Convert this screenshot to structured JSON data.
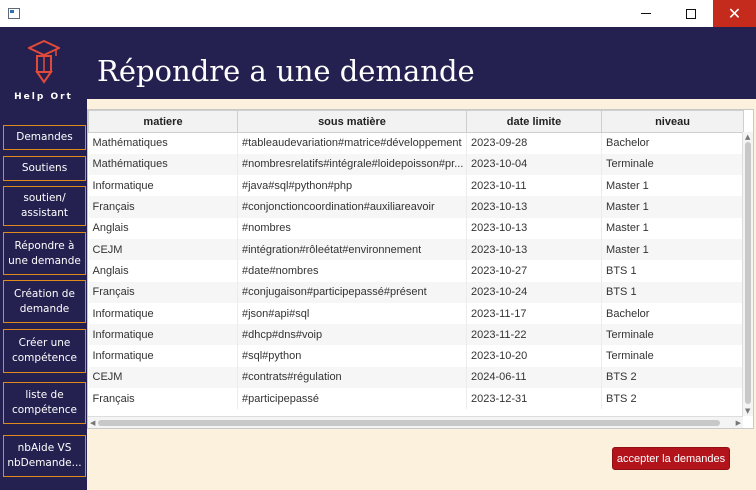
{
  "window": {
    "close_glyph": "✕"
  },
  "sidebar": {
    "logo_text": "Help Ort",
    "items": [
      {
        "label": "Demandes"
      },
      {
        "label": "Soutiens"
      },
      {
        "label": "soutien/ assistant"
      },
      {
        "label": "Répondre à une demande"
      },
      {
        "label": "Création de demande"
      },
      {
        "label": "Créer une compétence"
      },
      {
        "label": "liste de compétence"
      },
      {
        "label": "nbAide VS nbDemande..."
      }
    ]
  },
  "header": {
    "title": "Répondre a une demande"
  },
  "table": {
    "columns": [
      "matiere",
      "sous matière",
      "date limite",
      "niveau"
    ],
    "rows": [
      [
        "Mathématiques",
        "#tableaudevariation#matrice#développement",
        "2023-09-28",
        "Bachelor"
      ],
      [
        "Mathématiques",
        "#nombresrelatifs#intégrale#loidepoisson#pr...",
        "2023-10-04",
        "Terminale"
      ],
      [
        "Informatique",
        "#java#sql#python#php",
        "2023-10-11",
        "Master 1"
      ],
      [
        "Français",
        "#conjonctioncoordination#auxiliareavoir",
        "2023-10-13",
        "Master 1"
      ],
      [
        "Anglais",
        "#nombres",
        "2023-10-13",
        "Master 1"
      ],
      [
        "CEJM",
        "#intégration#rôleétat#environnement",
        "2023-10-13",
        "Master 1"
      ],
      [
        "Anglais",
        "#date#nombres",
        "2023-10-27",
        "BTS 1"
      ],
      [
        "Français",
        "#conjugaison#participepassé#présent",
        "2023-10-24",
        "BTS 1"
      ],
      [
        "Informatique",
        "#json#api#sql",
        "2023-11-17",
        "Bachelor"
      ],
      [
        "Informatique",
        "#dhcp#dns#voip",
        "2023-11-22",
        "Terminale"
      ],
      [
        "Informatique",
        "#sql#python",
        "2023-10-20",
        "Terminale"
      ],
      [
        "CEJM",
        "#contrats#régulation",
        "2024-06-11",
        "BTS 2"
      ],
      [
        "Français",
        "#participepassé",
        "2023-12-31",
        "BTS 2"
      ]
    ]
  },
  "actions": {
    "accept_label": "accepter la demandes"
  },
  "icons": {
    "logo": "graduation-pencil-icon",
    "minimize": "minimize-icon",
    "maximize": "maximize-icon",
    "close": "close-icon"
  },
  "colors": {
    "sidebar_bg": "#24204f",
    "nav_border": "#e08a1c",
    "main_bg": "#fbf1dc",
    "accept_bg": "#b3141b",
    "logo_accent": "#e14a3b"
  }
}
